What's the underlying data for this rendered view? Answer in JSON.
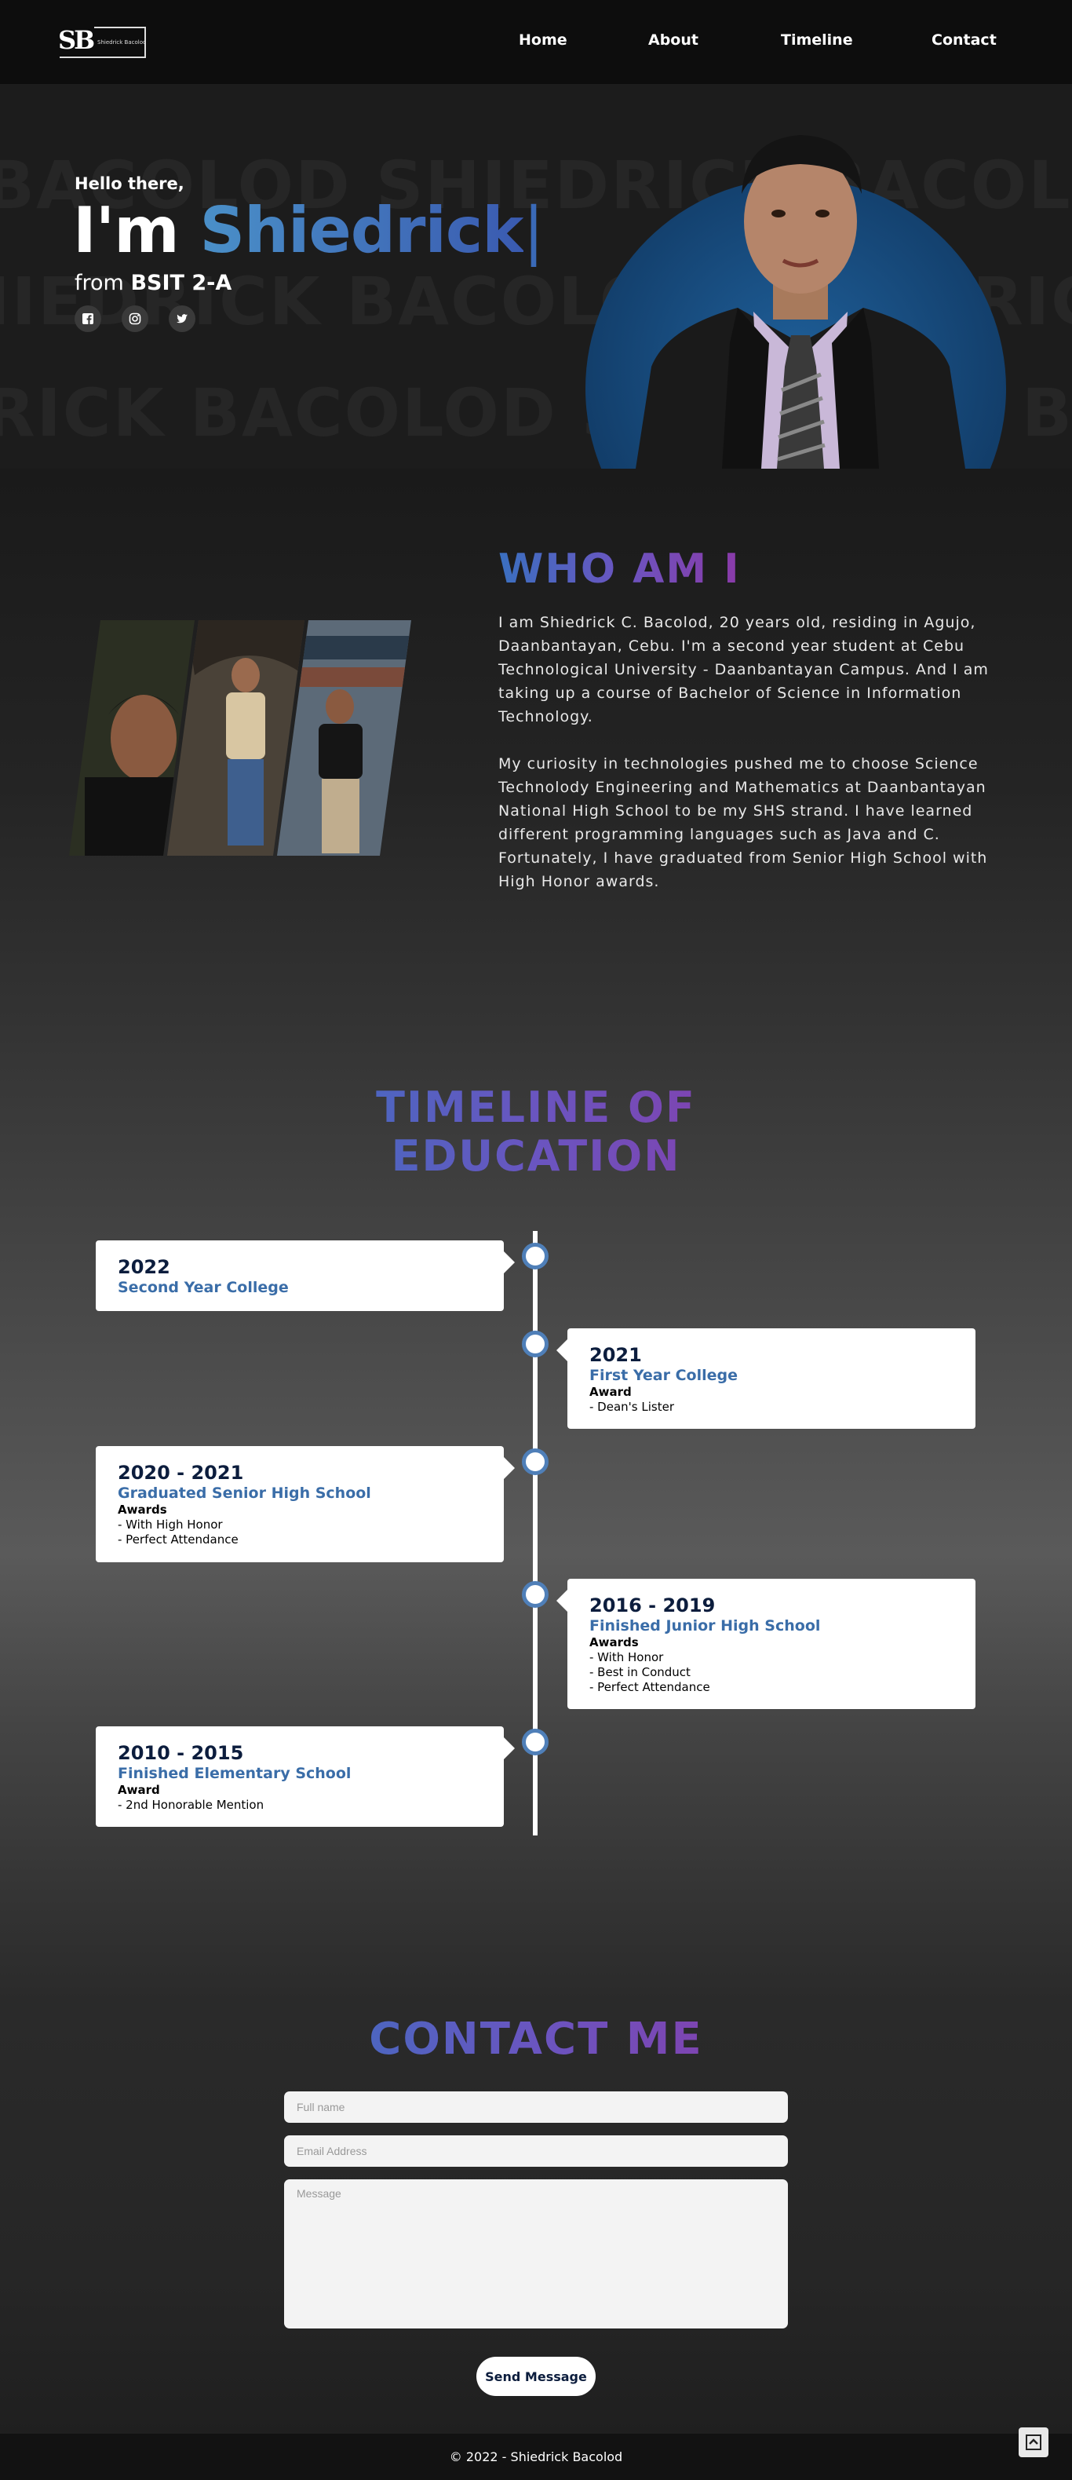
{
  "nav": {
    "logo_mark": "SB",
    "logo_text": "Shiedrick Bacolod",
    "links": [
      "Home",
      "About",
      "Timeline",
      "Contact"
    ]
  },
  "hero": {
    "background_words": [
      "BACOLOD SHIEDRICK BACOLOD SHIEDRICK",
      "SHIEDRICK BACOLOD SHIEDRICK BACOLOD",
      "RICK BACOLOD SHIEDRICK BACOLOD SHIEDRICK"
    ],
    "greeting": "Hello there,",
    "im": "I'm",
    "name": "Shiedrick",
    "cursor": "|",
    "from_prefix": "from",
    "from_section": "BSIT 2-A",
    "social_icons": [
      "facebook-icon",
      "instagram-icon",
      "twitter-icon"
    ]
  },
  "about": {
    "title": "WHO AM I",
    "paragraphs": [
      "I am Shiedrick C. Bacolod, 20 years old, residing in Agujo, Daanbantayan, Cebu. I'm a second year student at Cebu Technological University - Daanbantayan Campus. And I am taking up a course of Bachelor of Science in Information Technology.",
      "My curiosity in technologies pushed me to choose Science Technolody Engineering and Mathematics at Daanbantayan National High School to be my SHS strand. I have learned different programming languages such as Java and C. Fortunately, I have graduated from Senior High School with High Honor awards."
    ]
  },
  "timeline": {
    "title_line1": "TIMELINE OF",
    "title_line2": "EDUCATION",
    "entries": [
      {
        "year": "2022",
        "title": "Second Year College",
        "award_label": "",
        "items": []
      },
      {
        "year": "2021",
        "title": "First Year College",
        "award_label": "Award",
        "items": [
          "- Dean's Lister"
        ]
      },
      {
        "year": "2020 - 2021",
        "title": "Graduated Senior High School",
        "award_label": "Awards",
        "items": [
          "- With High Honor",
          "- Perfect Attendance"
        ]
      },
      {
        "year": "2016 - 2019",
        "title": "Finished Junior High School",
        "award_label": "Awards",
        "items": [
          "- With Honor",
          "- Best in Conduct",
          "- Perfect Attendance"
        ]
      },
      {
        "year": "2010 - 2015",
        "title": "Finished Elementary School",
        "award_label": "Award",
        "items": [
          "- 2nd Honorable Mention"
        ]
      }
    ]
  },
  "contact": {
    "title": "CONTACT ME",
    "fullname_placeholder": "Full name",
    "email_placeholder": "Email Address",
    "message_placeholder": "Message",
    "send_label": "Send Message"
  },
  "footer": {
    "copyright": "© 2022 - Shiedrick Bacolod"
  },
  "colors": {
    "accent_blue": "#3a6da8",
    "accent_purple": "#8a3aa8",
    "timeline_dot_border": "#4f7fb8",
    "portrait_circle": "#1f5f99"
  }
}
